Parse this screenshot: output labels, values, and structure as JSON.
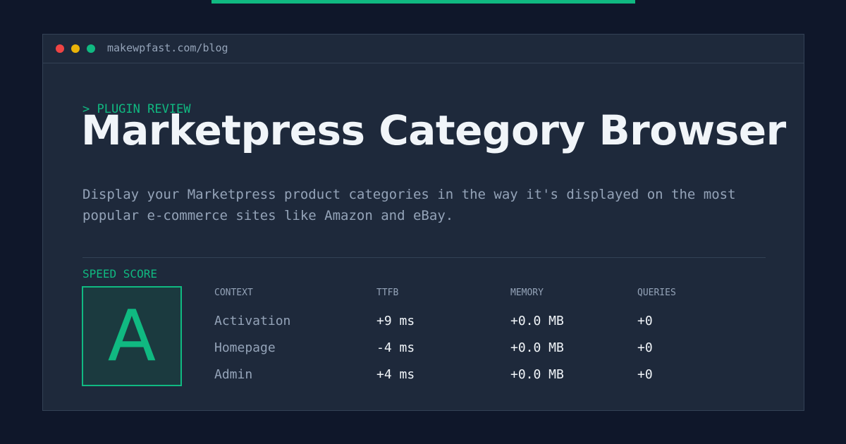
{
  "window": {
    "url": "makewpfast.com/blog"
  },
  "post": {
    "kicker": "> PLUGIN REVIEW",
    "title": "Marketpress Category Browser",
    "description": "Display your Marketpress product categories in the way it's displayed on the most popular e-commerce sites like Amazon and eBay."
  },
  "speed": {
    "label": "SPEED SCORE",
    "grade": "A",
    "headers": [
      "CONTEXT",
      "TTFB",
      "MEMORY",
      "QUERIES"
    ],
    "rows": [
      {
        "context": "Activation",
        "ttfb": "+9 ms",
        "memory": "+0.0 MB",
        "queries": "+0"
      },
      {
        "context": "Homepage",
        "ttfb": "-4 ms",
        "memory": "+0.0 MB",
        "queries": "+0"
      },
      {
        "context": "Admin",
        "ttfb": "+4 ms",
        "memory": "+0.0 MB",
        "queries": "+0"
      }
    ]
  },
  "colors": {
    "background": "#0f172a",
    "card": "#1e293b",
    "accent": "#10b981",
    "text_primary": "#f1f5f9",
    "text_muted": "#94a3b8"
  }
}
